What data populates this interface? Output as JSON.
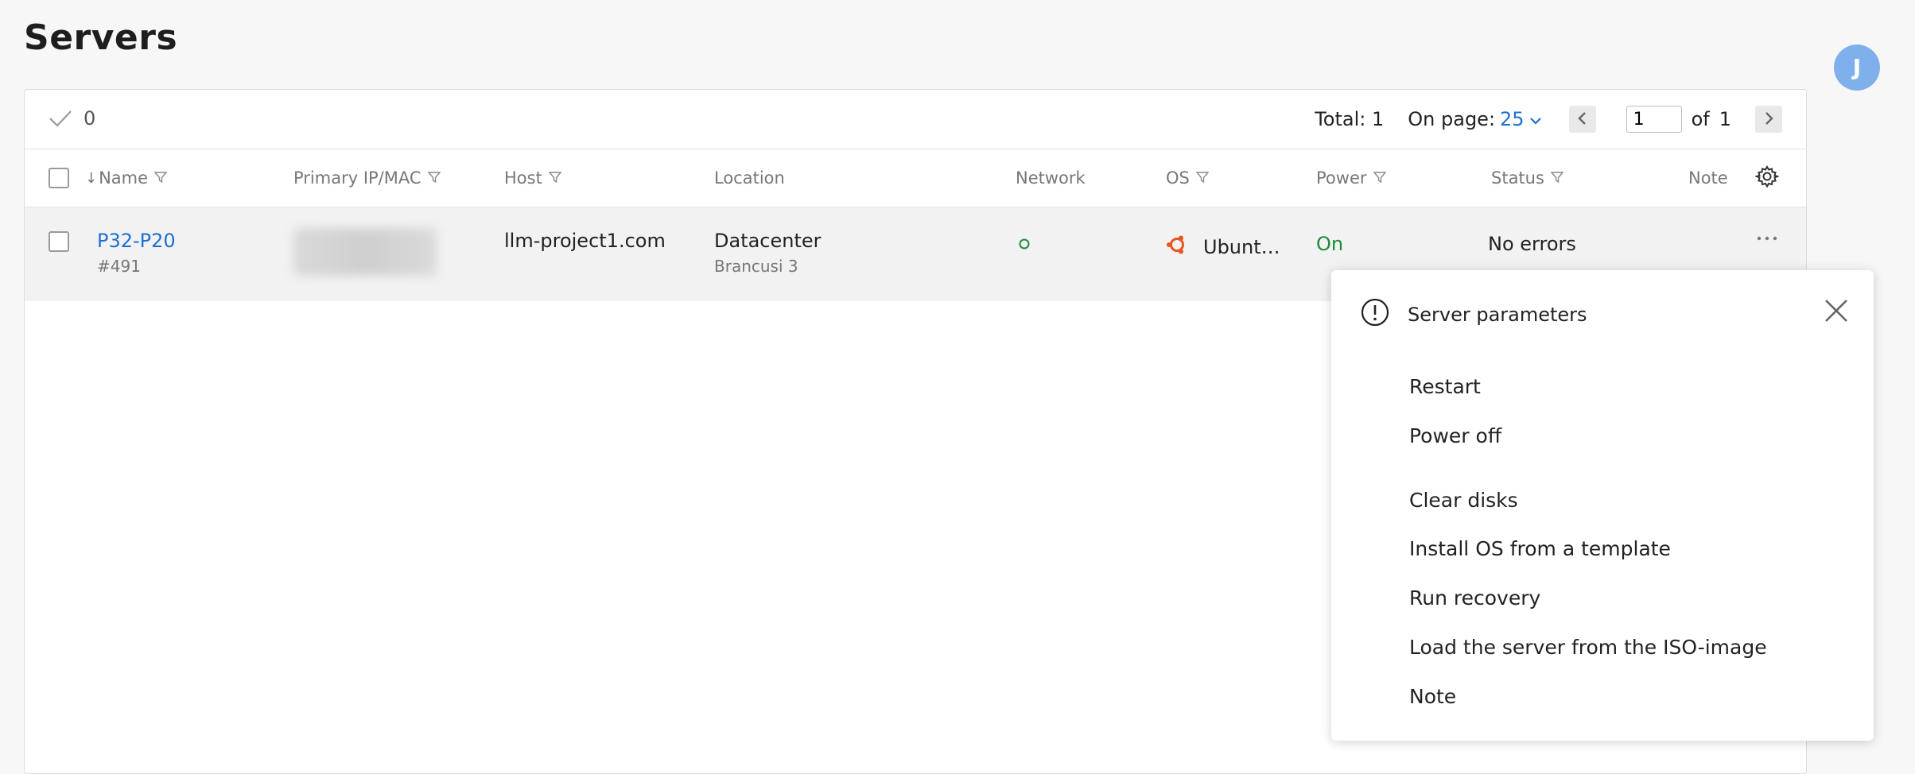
{
  "page": {
    "title": "Servers",
    "user_initial": "J"
  },
  "toolbar": {
    "selected_count": "0",
    "total_label": "Total: 1",
    "on_page_label": "On page:",
    "on_page_value": "25",
    "current_page": "1",
    "of_label": "of",
    "total_pages": "1"
  },
  "table": {
    "columns": [
      "Name",
      "Primary IP/MAC",
      "Host",
      "Location",
      "Network",
      "OS",
      "Power",
      "Status",
      "Note"
    ],
    "rows": [
      {
        "name": "P32-P20",
        "id": "#491",
        "host": "llm-project1.com",
        "location": "Datacenter",
        "location_sub": "Brancusi 3",
        "os": "Ubunt…",
        "power": "On",
        "status": "No errors"
      }
    ]
  },
  "context_menu": {
    "title": "Server parameters",
    "items": [
      "Restart",
      "Power off",
      "Clear disks",
      "Install OS from a template",
      "Run recovery",
      "Load the server from the ISO-image",
      "Note"
    ]
  },
  "colors": {
    "accent": "#1f6fd1",
    "success": "#1f8a3a",
    "avatar": "#7fb0ec"
  }
}
